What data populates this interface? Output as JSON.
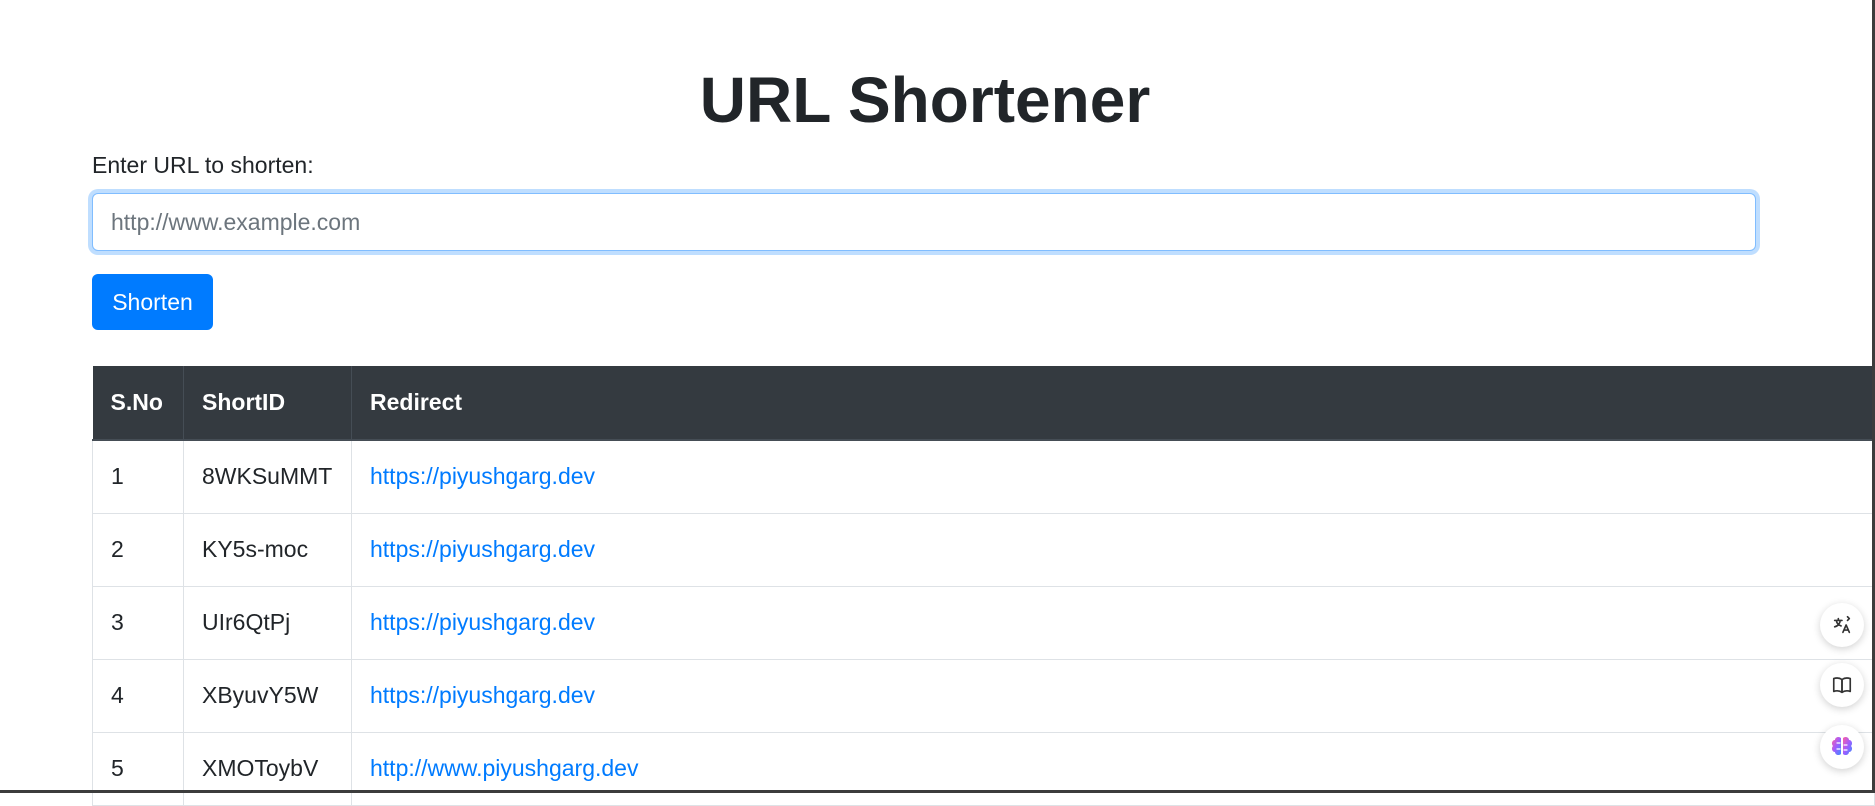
{
  "page": {
    "title": "URL Shortener"
  },
  "form": {
    "label": "Enter URL to shorten:",
    "input_value": "",
    "input_placeholder": "http://www.example.com",
    "submit_label": "Shorten"
  },
  "table": {
    "headers": [
      "S.No",
      "ShortID",
      "Redirect"
    ],
    "rows": [
      {
        "sno": "1",
        "short_id": "8WKSuMMT",
        "redirect": "https://piyushgarg.dev"
      },
      {
        "sno": "2",
        "short_id": "KY5s-moc",
        "redirect": "https://piyushgarg.dev"
      },
      {
        "sno": "3",
        "short_id": "UIr6QtPj",
        "redirect": "https://piyushgarg.dev"
      },
      {
        "sno": "4",
        "short_id": "XByuvY5W",
        "redirect": "https://piyushgarg.dev"
      },
      {
        "sno": "5",
        "short_id": "XMOToybV",
        "redirect": "http://www.piyushgarg.dev"
      }
    ]
  },
  "floating_tools": [
    {
      "icon": "translate-icon"
    },
    {
      "icon": "reader-icon"
    },
    {
      "icon": "ai-brain-icon"
    }
  ],
  "colors": {
    "primary": "#007bff",
    "table_header_bg": "#343a40",
    "link": "#007bff",
    "text": "#212529"
  }
}
